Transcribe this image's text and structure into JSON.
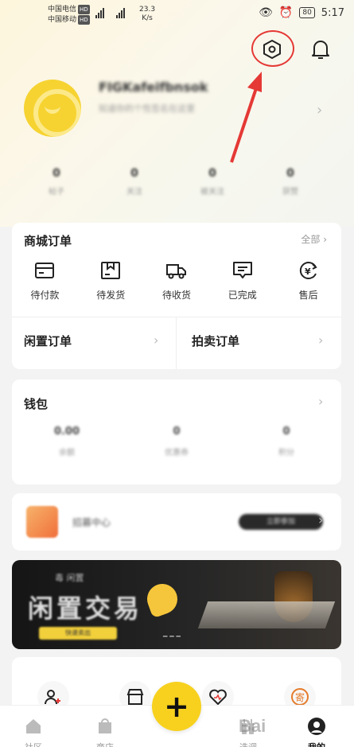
{
  "status_bar": {
    "carrier1": "中国电信",
    "carrier2": "中国移动",
    "hd": "HD",
    "net_speed_value": "23.3",
    "net_speed_unit": "K/s",
    "battery": "80",
    "time": "5:17"
  },
  "profile": {
    "username": "FIGKafeifbnsok",
    "bio": "知道你的个性签名在这里",
    "stats": [
      {
        "value": "0",
        "label": "帖子"
      },
      {
        "value": "0",
        "label": "关注"
      },
      {
        "value": "0",
        "label": "被关注"
      },
      {
        "value": "0",
        "label": "获赞"
      }
    ]
  },
  "mall_orders": {
    "title": "商城订单",
    "see_all": "全部",
    "items": [
      {
        "label": "待付款",
        "icon": "card-icon"
      },
      {
        "label": "待发货",
        "icon": "box-icon"
      },
      {
        "label": "待收货",
        "icon": "truck-icon"
      },
      {
        "label": "已完成",
        "icon": "message-check-icon"
      },
      {
        "label": "售后",
        "icon": "yuan-refresh-icon"
      }
    ],
    "idle_orders": "闲置订单",
    "auction_orders": "拍卖订单"
  },
  "wallet": {
    "title": "钱包",
    "items": [
      {
        "value": "0.00",
        "label": "余额"
      },
      {
        "value": "0",
        "label": "优惠券"
      },
      {
        "value": "0",
        "label": "积分"
      }
    ]
  },
  "promo": {
    "text": "招募中心",
    "badge": "立即参加"
  },
  "banner": {
    "small": "毒 闲置",
    "title": "闲置交易",
    "button": "快速卖出"
  },
  "tabbar": {
    "tabs": [
      {
        "label": "社区",
        "icon": "home-icon"
      },
      {
        "label": "商店",
        "icon": "shop-bag-icon"
      },
      {
        "label": "选调",
        "icon": "bottles-icon"
      },
      {
        "label": "我的",
        "icon": "avatar-icon"
      }
    ],
    "fab": "+"
  },
  "watermark": "Bai"
}
